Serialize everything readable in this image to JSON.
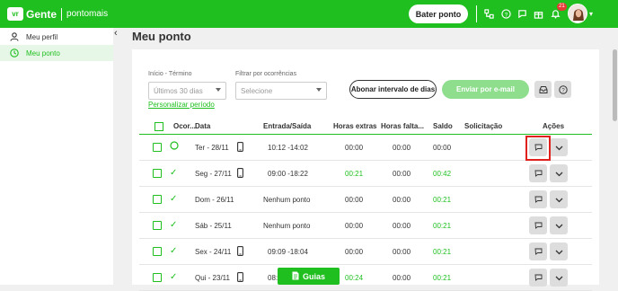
{
  "header": {
    "logo_badge": "vr",
    "brand": "Gente",
    "brand_sub": "pontomais",
    "clock_in_button": "Bater ponto",
    "notification_count": "21",
    "accent_color": "#1fbf1f"
  },
  "sidebar": {
    "items": [
      {
        "label": "Meu perfil",
        "icon": "person-icon"
      },
      {
        "label": "Meu ponto",
        "icon": "clock-icon",
        "active": true
      }
    ],
    "collapse_glyph": "‹"
  },
  "page": {
    "title": "Meu ponto"
  },
  "filters": {
    "period_label": "Início - Término",
    "period_placeholder": "Últimos 30 dias",
    "occurrence_label": "Filtrar por ocorrências",
    "occurrence_placeholder": "Selecione",
    "custom_period_link": "Personalizar período",
    "abonar_button": "Abonar intervalo de dias",
    "email_button": "Enviar por e-mail"
  },
  "table": {
    "headers": [
      "Ocor...",
      "Data",
      "Entrada/Saída",
      "Horas extras",
      "Horas falta...",
      "Saldo",
      "Solicitação",
      "Ações"
    ],
    "rows": [
      {
        "occurrence": "○",
        "date": "Ter - 28/11",
        "device": true,
        "times": "10:12 -14:02",
        "extra": "00:00",
        "missing": "00:00",
        "balance": "00:00",
        "extra_green": false,
        "balance_green": false
      },
      {
        "occurrence": "✓",
        "date": "Seg - 27/11",
        "device": true,
        "times": "09:00 -18:22",
        "extra": "00:21",
        "missing": "00:00",
        "balance": "00:42",
        "extra_green": true,
        "balance_green": true
      },
      {
        "occurrence": "✓",
        "date": "Dom - 26/11",
        "device": false,
        "times": "Nenhum ponto",
        "extra": "00:00",
        "missing": "00:00",
        "balance": "00:21",
        "extra_green": false,
        "balance_green": true
      },
      {
        "occurrence": "✓",
        "date": "Sáb - 25/11",
        "device": false,
        "times": "Nenhum ponto",
        "extra": "00:00",
        "missing": "00:00",
        "balance": "00:21",
        "extra_green": false,
        "balance_green": true
      },
      {
        "occurrence": "✓",
        "date": "Sex - 24/11",
        "device": true,
        "times": "09:09 -18:04",
        "extra": "00:00",
        "missing": "00:00",
        "balance": "00:21",
        "extra_green": false,
        "balance_green": true
      },
      {
        "occurrence": "✓",
        "date": "Qui - 23/11",
        "device": true,
        "times": "08:",
        "extra": "00:24",
        "missing": "00:00",
        "balance": "00:21",
        "extra_green": true,
        "balance_green": true
      }
    ]
  },
  "footer": {
    "guias_button": "Guias"
  }
}
